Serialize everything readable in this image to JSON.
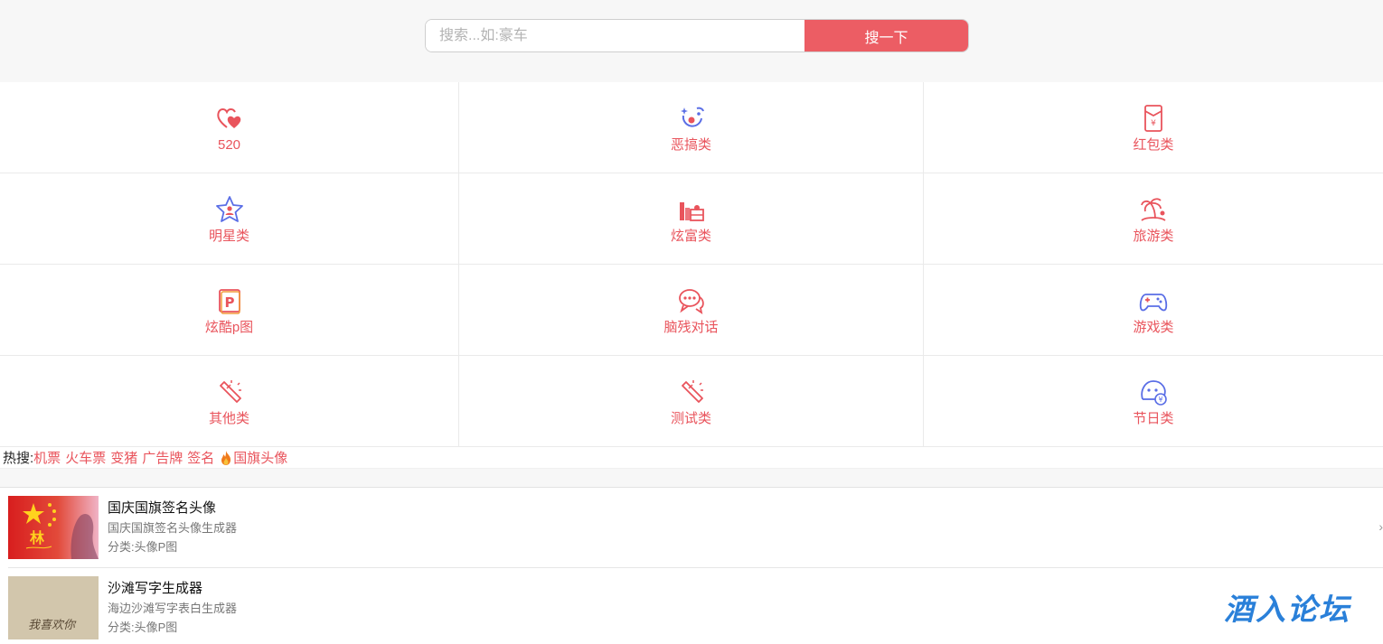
{
  "search": {
    "placeholder": "搜索...如:豪车",
    "button_label": "搜一下"
  },
  "categories": [
    {
      "label": "520",
      "icon": "hearts-icon"
    },
    {
      "label": "恶搞类",
      "icon": "clown-face-icon"
    },
    {
      "label": "红包类",
      "icon": "red-envelope-icon"
    },
    {
      "label": "明星类",
      "icon": "star-person-icon"
    },
    {
      "label": "炫富类",
      "icon": "money-stack-icon"
    },
    {
      "label": "旅游类",
      "icon": "beach-palm-icon"
    },
    {
      "label": "炫酷p图",
      "icon": "p-badge-icon"
    },
    {
      "label": "脑残对话",
      "icon": "chat-bubbles-icon"
    },
    {
      "label": "游戏类",
      "icon": "gamepad-icon"
    },
    {
      "label": "其他类",
      "icon": "magic-wand-icon"
    },
    {
      "label": "测试类",
      "icon": "magic-wand-icon"
    },
    {
      "label": "节日类",
      "icon": "holiday-face-icon"
    }
  ],
  "hot_search": {
    "title": "热搜:",
    "links": [
      "机票",
      "火车票",
      "变猪",
      "广告牌",
      "签名",
      "国旗头像"
    ]
  },
  "list": [
    {
      "title": "国庆国旗签名头像",
      "desc": "国庆国旗签名头像生成器",
      "category": "分类:头像P图",
      "thumb_text": "林"
    },
    {
      "title": "沙滩写字生成器",
      "desc": "海边沙滩写字表白生成器",
      "category": "分类:头像P图",
      "thumb_text": "我喜欢你"
    }
  ],
  "watermark": "酒入论坛",
  "colors": {
    "accent": "#ec5d64",
    "label": "#e9545c",
    "icon_blue": "#5a6ee6",
    "watermark": "#2a80d9"
  }
}
